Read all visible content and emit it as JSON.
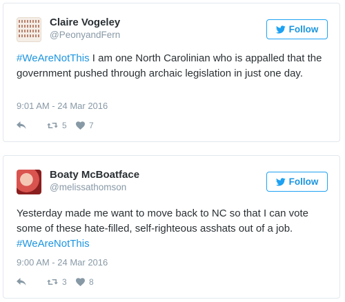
{
  "tweets": [
    {
      "display_name": "Claire Vogeley",
      "handle": "@PeonyandFern",
      "follow_label": "Follow",
      "text_parts": [
        "#WeAreNotThis",
        " I am one North Carolinian who is appalled that the government pushed through archaic legislation in just one day."
      ],
      "timestamp": "9:01 AM - 24 Mar 2016",
      "retweets": "5",
      "likes": "7"
    },
    {
      "display_name": "Boaty McBoatface",
      "handle": "@melissathomson",
      "follow_label": "Follow",
      "text_parts": [
        "Yesterday made me want to move back to NC so that I can vote some of these hate-filled, self-righteous asshats out of a job.",
        "#WeAreNotThis"
      ],
      "timestamp": "9:00 AM - 24 Mar 2016",
      "retweets": "3",
      "likes": "8"
    }
  ],
  "colors": {
    "link": "#1b95e0",
    "muted": "#8899a6",
    "text": "#292f33",
    "border": "#e1e8ed"
  },
  "icons": [
    "twitter-bird-icon",
    "reply-icon",
    "retweet-icon",
    "heart-icon"
  ]
}
